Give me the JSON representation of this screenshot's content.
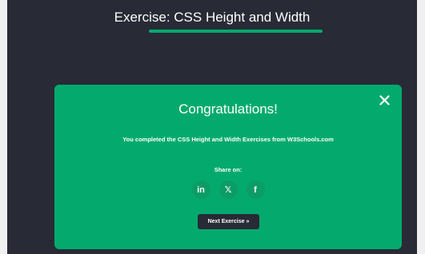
{
  "header": {
    "title": "Exercise: CSS Height and Width"
  },
  "modal": {
    "close_icon": "close-icon",
    "heading": "Congratulations!",
    "message": "You completed the CSS Height and Width Exercises from W3Schools.com",
    "share_label": "Share on:",
    "share_buttons": [
      {
        "network": "linkedin",
        "glyph": "in"
      },
      {
        "network": "x",
        "glyph": "𝕏"
      },
      {
        "network": "facebook",
        "glyph": "f"
      }
    ],
    "next_button": "Next Exercise »"
  },
  "colors": {
    "accent": "#04aa6d",
    "dark": "#282a35",
    "text": "#ffffff"
  }
}
